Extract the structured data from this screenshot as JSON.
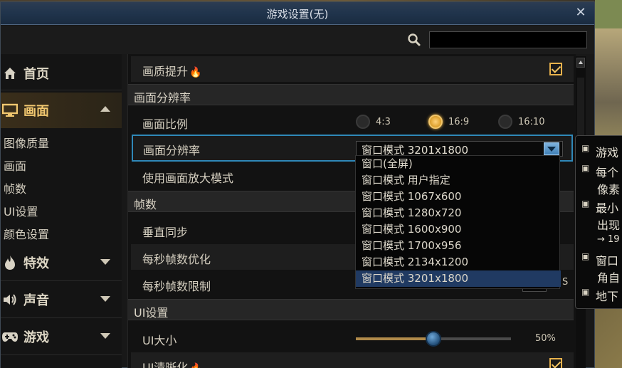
{
  "window": {
    "title": "游戏设置(无)",
    "close_label": "✕"
  },
  "search": {
    "value": "",
    "placeholder": ""
  },
  "sidebar": {
    "items": [
      {
        "label": "首页",
        "icon": "home-icon",
        "active": false
      },
      {
        "label": "画面",
        "icon": "monitor-icon",
        "active": true
      },
      {
        "label": "特效",
        "icon": "flame-icon",
        "active": false
      },
      {
        "label": "声音",
        "icon": "speaker-icon",
        "active": false
      },
      {
        "label": "游戏",
        "icon": "gamepad-icon",
        "active": false
      }
    ],
    "sub_items": [
      "图像质量",
      "画面",
      "帧数",
      "UI设置",
      "颜色设置"
    ]
  },
  "content": {
    "quality_boost": {
      "label": "画质提升",
      "checked": true
    },
    "section_resolution": "画面分辨率",
    "aspect_ratio": {
      "label": "画面比例",
      "options": [
        "4:3",
        "16:9",
        "16:10"
      ],
      "selected": "16:9"
    },
    "resolution": {
      "label": "画面分辨率",
      "value": "窗口模式 3201x1800"
    },
    "upscale": {
      "label": "使用画面放大模式"
    },
    "section_fps": "帧数",
    "vsync": {
      "label": "垂直同步"
    },
    "fps_optimize": {
      "label": "每秒帧数优化"
    },
    "fps_limit": {
      "label": "每秒帧数限制",
      "suffix": "S"
    },
    "section_ui": "UI设置",
    "ui_size": {
      "label": "UI大小",
      "value": "50%",
      "level": 0.5
    },
    "ui_sharpen": {
      "label": "UI清晰化",
      "checked": true
    }
  },
  "dropdown_options": [
    "窗口(全屏)",
    "窗口模式 用户指定",
    "窗口模式 1067x600",
    "窗口模式 1280x720",
    "窗口模式 1600x900",
    "窗口模式 1700x956",
    "窗口模式 2134x1200",
    "窗口模式 3201x1800"
  ],
  "tooltip_lines": [
    "游戏",
    "每个",
    "像素",
    "最小",
    "出现",
    "→ 19",
    "窗口",
    "角自",
    "地下"
  ],
  "colors": {
    "accent_gold": "#f2c463",
    "focus_blue": "#2f88b8",
    "selected_blue": "#203a62"
  }
}
